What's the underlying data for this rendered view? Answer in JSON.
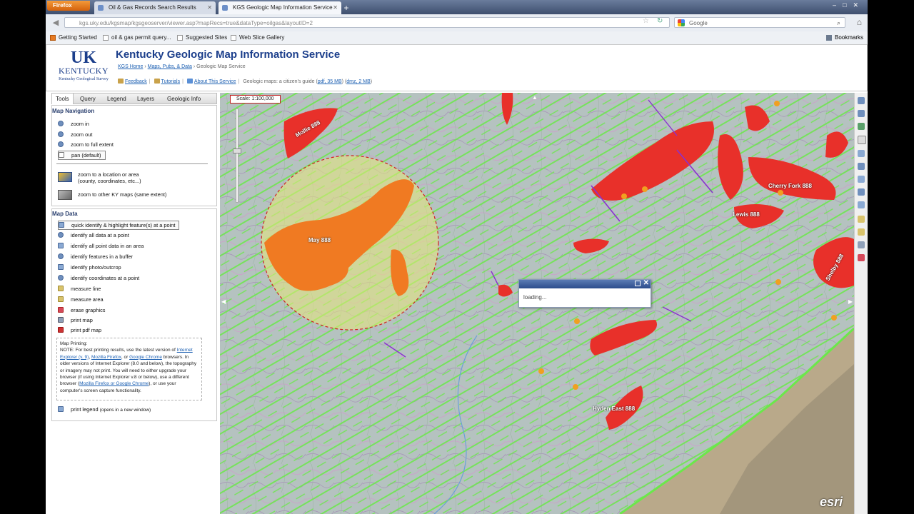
{
  "browser": {
    "app_button": "Firefox",
    "tabs": [
      {
        "label": "Oil & Gas Records Search Results"
      },
      {
        "label": "KGS Geologic Map Information Service"
      }
    ],
    "new_tab": "+",
    "url": "kgs.uky.edu/kgsmap/kgsgeoserver/viewer.asp?mapRecs=true&dataType=oilgas&layoutID=2",
    "search_placeholder": "Google",
    "bookmarks": [
      "Getting Started",
      "oil & gas permit query...",
      "Suggested Sites",
      "Web Slice Gallery"
    ],
    "bookmarks_menu": "Bookmarks"
  },
  "header": {
    "logo_main": "UK",
    "logo_sub": "KENTUCKY",
    "logo_org": "Kentucky Geological Survey",
    "title": "Kentucky Geologic Map Information Service",
    "breadcrumb": [
      "KGS Home",
      "Maps, Pubs, & Data",
      "Geologic Map Service"
    ],
    "links": [
      "Feedback",
      "Tutorials",
      "About This Service"
    ],
    "guide_text": "Geologic maps: a citizen's guide",
    "guide_pdf": "pdf, 35 MB",
    "guide_dmz": "dmz, 2 MB"
  },
  "panel": {
    "tabs": [
      "Tools",
      "Query",
      "Legend",
      "Layers",
      "Geologic Info"
    ],
    "nav_title": "Map Navigation",
    "nav_items": [
      "zoom in",
      "zoom out",
      "zoom to full extent",
      "pan (default)"
    ],
    "location_line1": "zoom to a location or area",
    "location_line2": "(county, coordinates, etc...)",
    "other_maps": "zoom to other KY maps (same extent)",
    "data_title": "Map Data",
    "data_items": [
      "quick identify & highlight feature(s) at a point",
      "identify all data at a point",
      "identify all point data in an area",
      "identify features in a buffer",
      "identify photo/outcrop",
      "identify coordinates at a point",
      "measure line",
      "measure area",
      "erase graphics",
      "print map",
      "print pdf map"
    ],
    "print_note_title": "Map Printing:",
    "print_note": {
      "p1": "NOTE: For best printing results, use the latest version of ",
      "ie": "Internet Explorer (v. 9)",
      "comma": ", ",
      "ff": "Mozilla Firefox",
      "or": ", or ",
      "gc": "Google Chrome",
      "p2": " browsers. In older versions of Internet Explorer (8.0 and below), the topography or imagery may not print. You will need to either upgrade your browser (if using Internet Explorer v.8 or below), use a different browser (",
      "ff2": "Mozilla Firefox or Google Chrome",
      "p3": "), or use your computer's screen capture functionality."
    },
    "print_legend": "print legend",
    "print_legend_note": "(opens in a new window)"
  },
  "map": {
    "scale": "Scale: 1:100,000",
    "loading": "loading...",
    "attribution": "esri",
    "labels": [
      "May 888",
      "Mollie 888",
      "Cherry Fork 888",
      "Lewis 888",
      "Shelby 888",
      "Hyden East 888"
    ]
  },
  "colors": {
    "header_blue": "#1b3e8b",
    "link_blue": "#1b5fb2",
    "field_red": "#e8302a",
    "field_orange": "#f07a22",
    "buffer_yellow": "#e6e87a",
    "green_wells": "#6be84a",
    "dialog_bar": "#2c4d8c"
  }
}
